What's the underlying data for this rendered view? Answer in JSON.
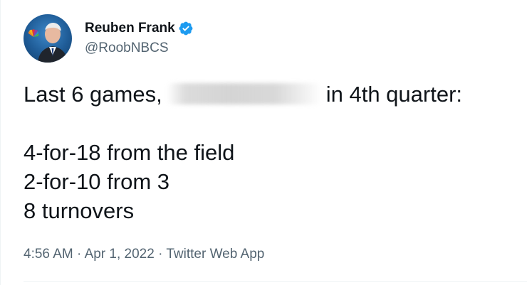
{
  "author": {
    "display_name": "Reuben Frank",
    "handle": "@RoobNBCS",
    "verified": true,
    "avatar_icon": "profile-photo",
    "colors": {
      "verified_badge": "#1d9bf0",
      "handle_text": "#536471"
    }
  },
  "tweet": {
    "line1_before": "Last 6 games,",
    "line1_after": "in 4th quarter:",
    "redacted": "blurred-name",
    "stats": [
      "4-for-18 from the field",
      "2-for-10 from 3",
      "8 turnovers"
    ]
  },
  "meta": {
    "time": "4:56 AM",
    "separator": "·",
    "date": "Apr 1, 2022",
    "source": "Twitter Web App"
  }
}
